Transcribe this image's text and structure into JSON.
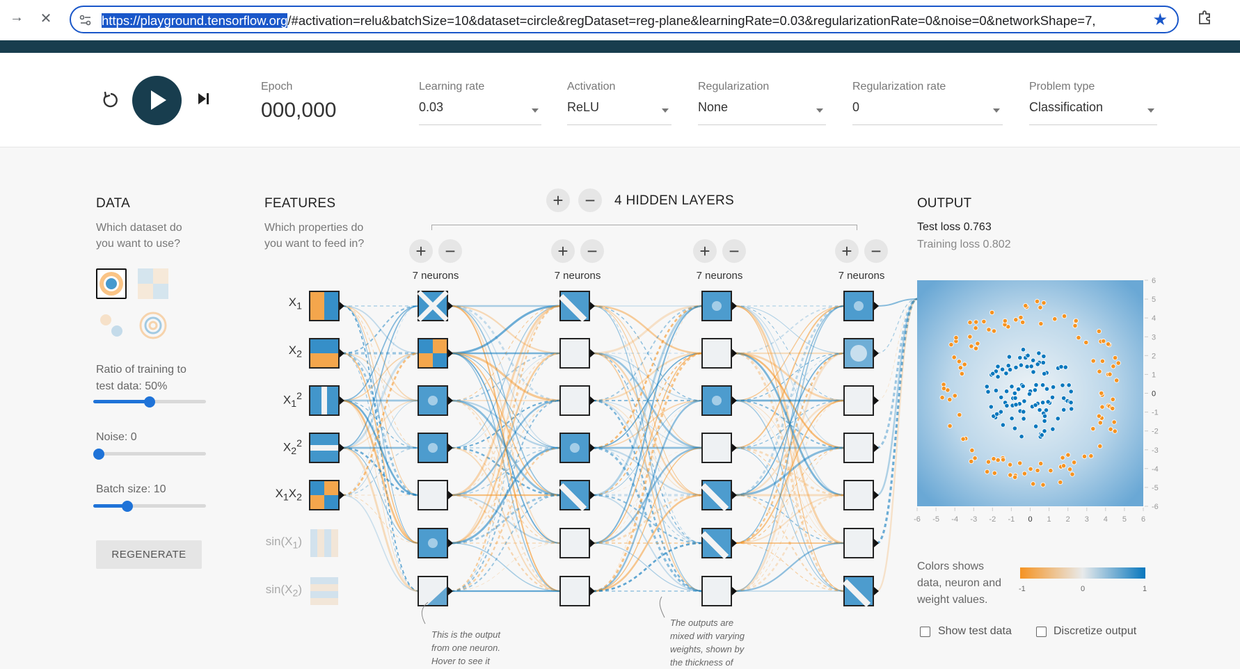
{
  "browser": {
    "back_icon": "arrow-right-icon",
    "url_host": "https://playground.tensorflow.org",
    "url_rest": "/#activation=relu&batchSize=10&dataset=circle&regDataset=reg-plane&learningRate=0.03&regularizationRate=0&noise=0&networkShape=7,"
  },
  "controls": {
    "epoch_label": "Epoch",
    "epoch_value": "000,000",
    "learning_rate_label": "Learning rate",
    "learning_rate_value": "0.03",
    "activation_label": "Activation",
    "activation_value": "ReLU",
    "regularization_label": "Regularization",
    "regularization_value": "None",
    "reg_rate_label": "Regularization rate",
    "reg_rate_value": "0",
    "problem_type_label": "Problem type",
    "problem_type_value": "Classification"
  },
  "data_panel": {
    "title": "DATA",
    "subtitle_line1": "Which dataset do",
    "subtitle_line2": "you want to use?",
    "ratio_label_line1": "Ratio of training to",
    "ratio_label_line2": "test data:  50%",
    "ratio_value": 0.5,
    "noise_label": "Noise:  0",
    "noise_value": 0,
    "batch_label": "Batch size:  10",
    "batch_value": 0.3,
    "regenerate_label": "REGENERATE"
  },
  "features_panel": {
    "title": "FEATURES",
    "subtitle_line1": "Which properties do",
    "subtitle_line2": "you want to feed in?"
  },
  "hidden_layers": {
    "title": "4   HIDDEN LAYERS",
    "layers": [
      {
        "label": "7 neurons"
      },
      {
        "label": "7 neurons"
      },
      {
        "label": "7 neurons"
      },
      {
        "label": "7 neurons"
      }
    ]
  },
  "output_panel": {
    "title": "OUTPUT",
    "test_loss": "Test loss 0.763",
    "training_loss": "Training loss 0.802",
    "x_ticks": [
      "-6",
      "-5",
      "-4",
      "-3",
      "-2",
      "-1",
      "0",
      "1",
      "2",
      "3",
      "4",
      "5",
      "6"
    ],
    "y_ticks": [
      "6",
      "5",
      "4",
      "3",
      "2",
      "1",
      "0",
      "-1",
      "-2",
      "-3",
      "-4",
      "-5",
      "-6"
    ],
    "legend_line1": "Colors shows",
    "legend_line2": "data, neuron and",
    "legend_line3": "weight values.",
    "legend_min": "-1",
    "legend_mid": "0",
    "legend_max": "1",
    "show_test_label": "Show test data",
    "discretize_label": "Discretize output"
  },
  "notes": {
    "neuron_note_line1": "This is the output",
    "neuron_note_line2": "from one neuron.",
    "neuron_note_line3": "Hover to see it",
    "weights_note_line1": "The outputs are",
    "weights_note_line2": "mixed with varying",
    "weights_note_line3": "weights, shown by",
    "weights_note_line4": "the thickness of"
  },
  "colors": {
    "positive": "#0877bd",
    "negative": "#f59322",
    "accent": "#183d4e"
  }
}
